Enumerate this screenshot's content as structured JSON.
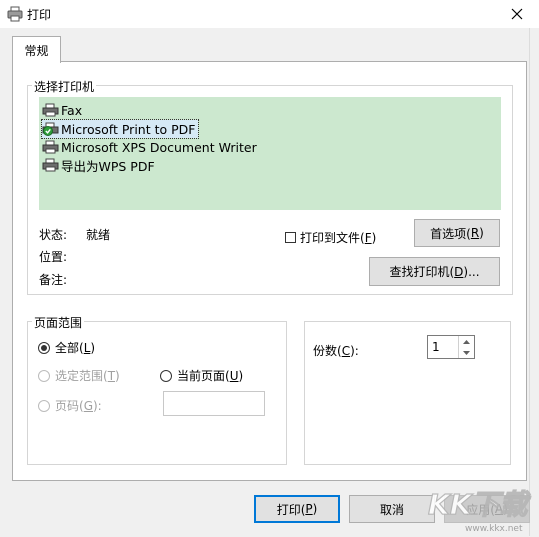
{
  "window": {
    "title": "打印",
    "close_icon": "close-icon",
    "printer_icon": "printer-icon"
  },
  "tabs": [
    {
      "label": "常规",
      "selected": true
    }
  ],
  "select_printer": {
    "group_label": "选择打印机",
    "printers": [
      {
        "name": "Fax",
        "icon": "fax-printer-icon",
        "selected": false
      },
      {
        "name": "Microsoft Print to PDF",
        "icon": "default-printer-icon",
        "selected": true
      },
      {
        "name": "Microsoft XPS Document Writer",
        "icon": "printer-icon",
        "selected": false
      },
      {
        "name": "导出为WPS PDF",
        "icon": "printer-icon",
        "selected": false
      }
    ],
    "list_bg": "#cce8cf",
    "status_label": "状态:",
    "status_value": "就绪",
    "location_label": "位置:",
    "comment_label": "备注:",
    "print_to_file_label": "打印到文件(",
    "print_to_file_key": "F",
    "print_to_file_checked": false,
    "preferences_label": "首选项(",
    "preferences_key": "R",
    "find_printer_label": "查找打印机(",
    "find_printer_key": "D",
    "find_printer_suffix": ")..."
  },
  "page_range": {
    "group_label": "页面范围",
    "all_label": "全部(",
    "all_key": "L",
    "all_checked": true,
    "selection_label": "选定范围(",
    "selection_key": "T",
    "current_page_label": "当前页面(",
    "current_page_key": "U",
    "pages_label": "页码(",
    "pages_key": "G",
    "pages_suffix": "):",
    "pages_value": ""
  },
  "copies": {
    "label": "份数(",
    "key": "C",
    "suffix": "):",
    "value": "1"
  },
  "buttons": {
    "print_label": "打印(",
    "print_key": "P",
    "cancel_label": "取消",
    "apply_label": "应用(",
    "apply_key": "A"
  },
  "watermark": {
    "text": "KK下载",
    "url": "www.kkx.net"
  },
  "colors": {
    "accent": "#0078d7",
    "list_bg": "#cce8cf",
    "watermark": "#b5b5b5"
  }
}
